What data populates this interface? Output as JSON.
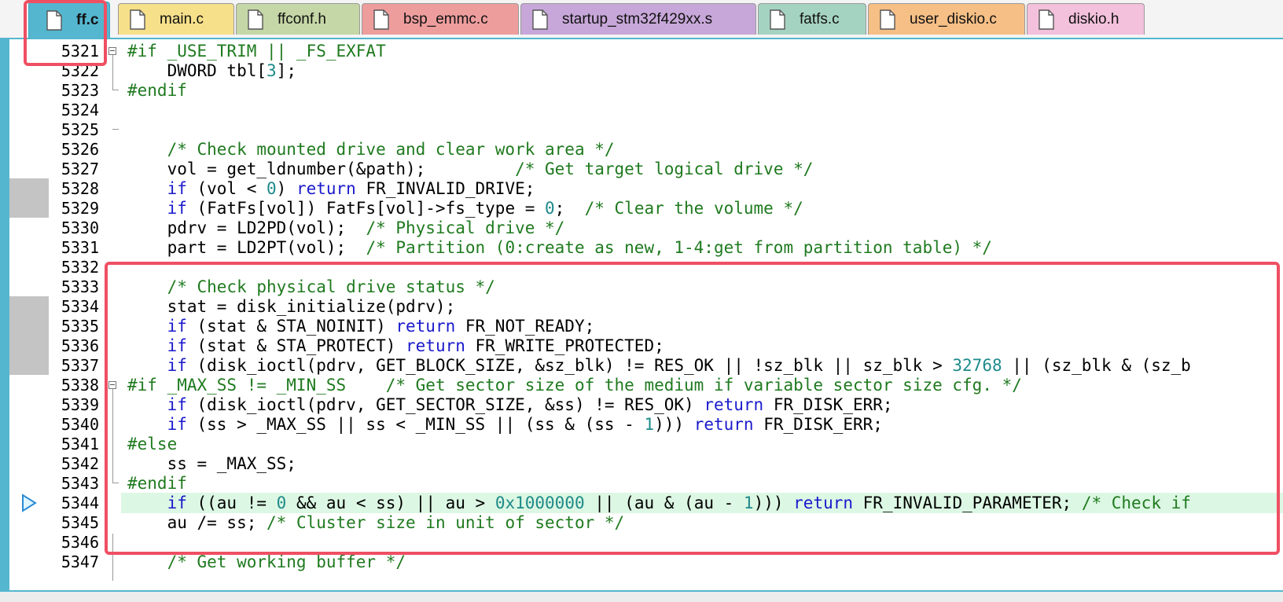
{
  "tabs": [
    {
      "label": "ff.c",
      "active": true,
      "color": "#55b6cf"
    },
    {
      "label": "main.c",
      "color": "#f7e08a"
    },
    {
      "label": "ffconf.h",
      "color": "#c5d7a6"
    },
    {
      "label": "bsp_emmc.c",
      "color": "#ee9d9d"
    },
    {
      "label": "startup_stm32f429xx.s",
      "color": "#c7a7d9"
    },
    {
      "label": "fatfs.c",
      "color": "#a5d3c2"
    },
    {
      "label": "user_diskio.c",
      "color": "#f6bf86"
    },
    {
      "label": "diskio.h",
      "color": "#f3c1dc"
    }
  ],
  "editor": {
    "lines": [
      {
        "num": "5321",
        "tokens": [
          [
            "pp",
            "#if _USE_TRIM || _FS_EXFAT"
          ]
        ]
      },
      {
        "num": "5322",
        "tokens": [
          [
            "",
            "    DWORD tbl["
          ],
          [
            "num",
            "3"
          ],
          [
            "",
            "];"
          ]
        ]
      },
      {
        "num": "5323",
        "tokens": [
          [
            "pp",
            "#endif"
          ]
        ]
      },
      {
        "num": "5324",
        "tokens": []
      },
      {
        "num": "5325",
        "tokens": []
      },
      {
        "num": "5326",
        "tokens": [
          [
            "cm",
            "    /* Check mounted drive and clear work area */"
          ]
        ]
      },
      {
        "num": "5327",
        "tokens": [
          [
            "",
            "    vol = get_ldnumber(&path);         "
          ],
          [
            "cm",
            "/* Get target logical drive */"
          ]
        ]
      },
      {
        "num": "5328",
        "tokens": [
          [
            "kw",
            "    if"
          ],
          [
            "",
            " (vol < "
          ],
          [
            "num",
            "0"
          ],
          [
            "",
            ") "
          ],
          [
            "kw",
            "return"
          ],
          [
            "",
            " FR_INVALID_DRIVE;"
          ]
        ]
      },
      {
        "num": "5329",
        "tokens": [
          [
            "kw",
            "    if"
          ],
          [
            "",
            " (FatFs[vol]) FatFs[vol]->fs_type = "
          ],
          [
            "num",
            "0"
          ],
          [
            "",
            ";  "
          ],
          [
            "cm",
            "/* Clear the volume */"
          ]
        ]
      },
      {
        "num": "5330",
        "tokens": [
          [
            "",
            "    pdrv = LD2PD(vol);  "
          ],
          [
            "cm",
            "/* Physical drive */"
          ]
        ]
      },
      {
        "num": "5331",
        "tokens": [
          [
            "",
            "    part = LD2PT(vol);  "
          ],
          [
            "cm",
            "/* Partition (0:create as new, 1-4:get from partition table) */"
          ]
        ]
      },
      {
        "num": "5332",
        "tokens": []
      },
      {
        "num": "5333",
        "tokens": [
          [
            "cm",
            "    /* Check physical drive status */"
          ]
        ]
      },
      {
        "num": "5334",
        "tokens": [
          [
            "",
            "    stat = disk_initialize(pdrv);"
          ]
        ]
      },
      {
        "num": "5335",
        "tokens": [
          [
            "kw",
            "    if"
          ],
          [
            "",
            " (stat & STA_NOINIT) "
          ],
          [
            "kw",
            "return"
          ],
          [
            "",
            " FR_NOT_READY;"
          ]
        ]
      },
      {
        "num": "5336",
        "tokens": [
          [
            "kw",
            "    if"
          ],
          [
            "",
            " (stat & STA_PROTECT) "
          ],
          [
            "kw",
            "return"
          ],
          [
            "",
            " FR_WRITE_PROTECTED;"
          ]
        ]
      },
      {
        "num": "5337",
        "tokens": [
          [
            "kw",
            "    if"
          ],
          [
            "",
            " (disk_ioctl(pdrv, GET_BLOCK_SIZE, &sz_blk) != RES_OK || !sz_blk || sz_blk > "
          ],
          [
            "num",
            "32768"
          ],
          [
            "",
            " || (sz_blk & (sz_b"
          ]
        ]
      },
      {
        "num": "5338",
        "tokens": [
          [
            "pp",
            "#if _MAX_SS != _MIN_SS    "
          ],
          [
            "cm",
            "/* Get sector size of the medium if variable sector size cfg. */"
          ]
        ]
      },
      {
        "num": "5339",
        "tokens": [
          [
            "kw",
            "    if"
          ],
          [
            "",
            " (disk_ioctl(pdrv, GET_SECTOR_SIZE, &ss) != RES_OK) "
          ],
          [
            "kw",
            "return"
          ],
          [
            "",
            " FR_DISK_ERR;"
          ]
        ]
      },
      {
        "num": "5340",
        "tokens": [
          [
            "kw",
            "    if"
          ],
          [
            "",
            " (ss > _MAX_SS || ss < _MIN_SS || (ss & (ss - "
          ],
          [
            "num",
            "1"
          ],
          [
            "",
            "))) "
          ],
          [
            "kw",
            "return"
          ],
          [
            "",
            " FR_DISK_ERR;"
          ]
        ]
      },
      {
        "num": "5341",
        "tokens": [
          [
            "pp",
            "#else"
          ]
        ]
      },
      {
        "num": "5342",
        "tokens": [
          [
            "",
            "    ss = _MAX_SS;"
          ]
        ]
      },
      {
        "num": "5343",
        "tokens": [
          [
            "pp",
            "#endif"
          ]
        ]
      },
      {
        "num": "5344",
        "tokens": [
          [
            "kw",
            "    if"
          ],
          [
            "",
            " ((au != "
          ],
          [
            "num",
            "0"
          ],
          [
            "",
            " && au < ss) || au > "
          ],
          [
            "num",
            "0x1000000"
          ],
          [
            "",
            " || (au & (au - "
          ],
          [
            "num",
            "1"
          ],
          [
            "",
            "))) "
          ],
          [
            "kw",
            "return"
          ],
          [
            "",
            " FR_INVALID_PARAMETER; "
          ],
          [
            "cm",
            "/* Check if"
          ]
        ]
      },
      {
        "num": "5345",
        "tokens": [
          [
            "",
            "    au /= ss; "
          ],
          [
            "cm",
            "/* Cluster size in unit of sector */"
          ]
        ]
      },
      {
        "num": "5346",
        "tokens": []
      },
      {
        "num": "5347",
        "tokens": [
          [
            "cm",
            "    /* Get working buffer */"
          ]
        ]
      }
    ],
    "current_line": "5344",
    "breakpoint_lines": [
      "5328",
      "5329",
      "5334",
      "5335",
      "5336",
      "5337"
    ],
    "fold_markers": [
      "5321",
      "5338"
    ],
    "icons": {
      "execution": "current-line-arrow-icon",
      "file": "file-icon",
      "fold": "fold-minus-icon"
    }
  }
}
